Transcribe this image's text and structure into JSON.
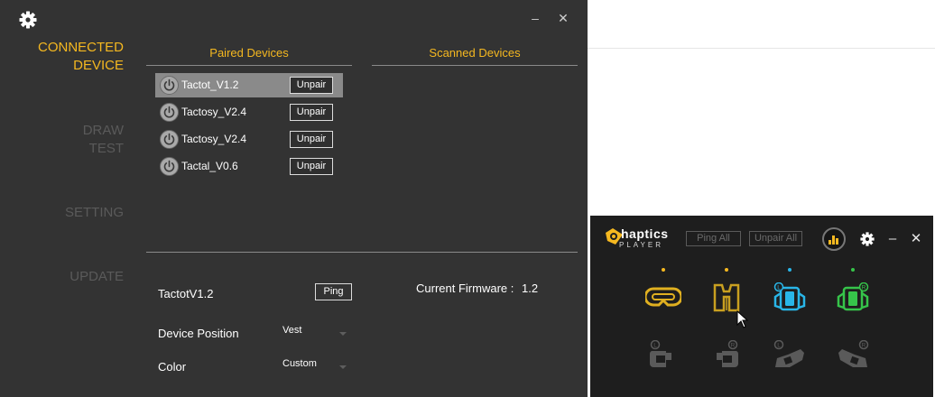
{
  "window": {
    "minimize_glyph": "–",
    "close_glyph": "✕"
  },
  "nav": {
    "items": [
      {
        "line1": "CONNECTED",
        "line2": "DEVICE",
        "active": true
      },
      {
        "line1": "DRAW",
        "line2": "TEST",
        "active": false
      },
      {
        "line1": "SETTING",
        "line2": "",
        "active": false
      },
      {
        "line1": "UPDATE",
        "line2": "",
        "active": false
      }
    ]
  },
  "paired": {
    "title": "Paired Devices",
    "unpair_label": "Unpair",
    "devices": [
      {
        "name": "Tactot_V1.2",
        "selected": true
      },
      {
        "name": "Tactosy_V2.4",
        "selected": false
      },
      {
        "name": "Tactosy_V2.4",
        "selected": false
      },
      {
        "name": "Tactal_V0.6",
        "selected": false
      }
    ]
  },
  "scanned": {
    "title": "Scanned Devices"
  },
  "detail": {
    "device_name": "TactotV1.2",
    "ping_label": "Ping",
    "firmware_label": "Current Firmware :",
    "firmware_value": "1.2",
    "position_label": "Device Position",
    "position_value": "Vest",
    "color_label": "Color",
    "color_value": "Custom"
  },
  "player": {
    "logo_text": "haptics",
    "logo_mark": "b",
    "logo_sub": "PLAYER",
    "ping_all_label": "Ping All",
    "unpair_all_label": "Unpair All",
    "minimize_glyph": "–",
    "close_glyph": "✕",
    "devices_row1": [
      {
        "icon": "head-visor-icon",
        "status_color": "#f5b820"
      },
      {
        "icon": "vest-icon",
        "status_color": "#f5b820"
      },
      {
        "icon": "left-arm-icon",
        "status_color": "#29b6e8"
      },
      {
        "icon": "right-arm-icon",
        "status_color": "#36c44a"
      }
    ],
    "devices_row2": [
      {
        "icon": "left-hand-icon",
        "status_color": "#5a5a5a"
      },
      {
        "icon": "right-hand-icon",
        "status_color": "#5a5a5a"
      },
      {
        "icon": "left-foot-icon",
        "status_color": "#5a5a5a"
      },
      {
        "icon": "right-foot-icon",
        "status_color": "#5a5a5a"
      }
    ]
  },
  "colors": {
    "accent": "#f5b820",
    "window_bg": "#333333",
    "selected_row": "#8a8a8a",
    "player_bg": "#1e1e1e",
    "blue": "#29b6e8",
    "green": "#36c44a"
  }
}
